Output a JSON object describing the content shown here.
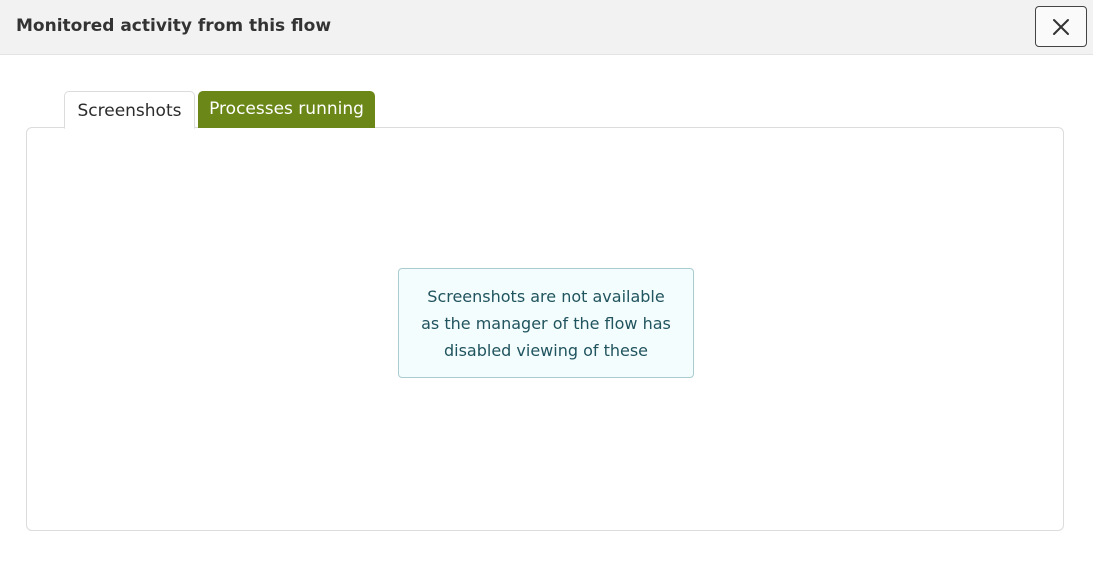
{
  "modal": {
    "title": "Monitored activity from this flow",
    "close_icon": "close-icon"
  },
  "tabs": [
    {
      "label": "Screenshots",
      "active": true
    },
    {
      "label": "Processes running",
      "active": false
    }
  ],
  "notice": {
    "lines": [
      "Screenshots are not available",
      "as the manager of the flow has",
      "disabled viewing of these"
    ]
  },
  "colors": {
    "header_bg": "#f2f2f2",
    "tab_accent": "#6b8717",
    "notice_bg": "#f4fdfd",
    "notice_border": "#a9cccf",
    "notice_text": "#20545e"
  }
}
